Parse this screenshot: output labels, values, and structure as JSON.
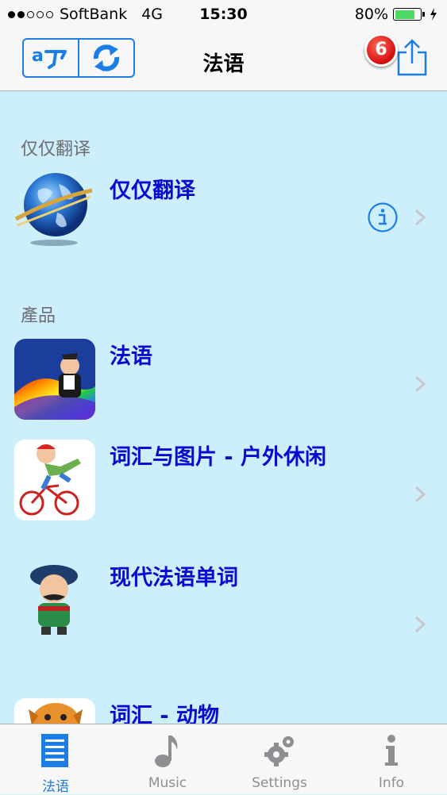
{
  "status_bar": {
    "carrier": "SoftBank",
    "network": "4G",
    "time": "15:30",
    "battery": "80%",
    "battery_level": 0.8
  },
  "nav": {
    "title": "法语",
    "badge_count": "6",
    "left_segment_icons": [
      "translate-icon",
      "refresh-icon"
    ],
    "right_icon": "share-icon"
  },
  "sections": [
    {
      "header": "仅仅翻译",
      "items": [
        {
          "title": "仅仅翻译",
          "icon": "globe-icon",
          "has_info": true
        }
      ]
    },
    {
      "header": "產品",
      "items": [
        {
          "title": "法语",
          "icon": "app-icon-french"
        },
        {
          "title": "词汇与图片 - 户外休闲",
          "icon": "app-icon-outdoor"
        },
        {
          "title": "现代法语单词",
          "icon": "app-icon-modern-words"
        },
        {
          "title": "词汇 - 动物",
          "icon": "app-icon-animals"
        }
      ]
    }
  ],
  "tabs": [
    {
      "label": "法语",
      "icon": "list-icon",
      "active": true
    },
    {
      "label": "Music",
      "icon": "music-note-icon",
      "active": false
    },
    {
      "label": "Settings",
      "icon": "gears-icon",
      "active": false
    },
    {
      "label": "Info",
      "icon": "info-icon",
      "active": false
    }
  ],
  "colors": {
    "background": "#cdeefb",
    "accent": "#1a7ee6",
    "item_title": "#0a0ad0",
    "badge": "#e01818",
    "battery_fill": "#4cd964"
  }
}
